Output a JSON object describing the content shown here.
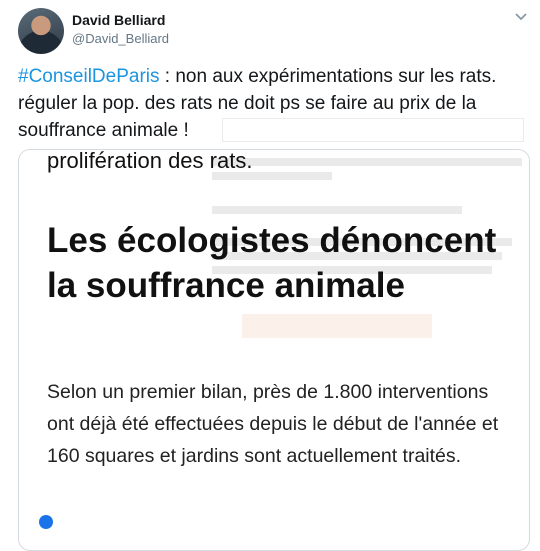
{
  "author": {
    "name": "David Belliard",
    "handle": "@David_Belliard"
  },
  "tweet": {
    "hashtag": "#ConseilDeParis",
    "text": " : non aux expérimentations sur les rats. réguler la pop. des rats ne doit ps se faire au prix de la souffrance animale !"
  },
  "card": {
    "cut_text": "prolifération des rats.",
    "title": "Les écologistes dénoncent la souffrance animale",
    "body": "Selon un premier bilan, près de 1.800 interventions ont déjà été effectuées depuis le début de l'année et 160 squares et jardins sont actuellement traités."
  }
}
